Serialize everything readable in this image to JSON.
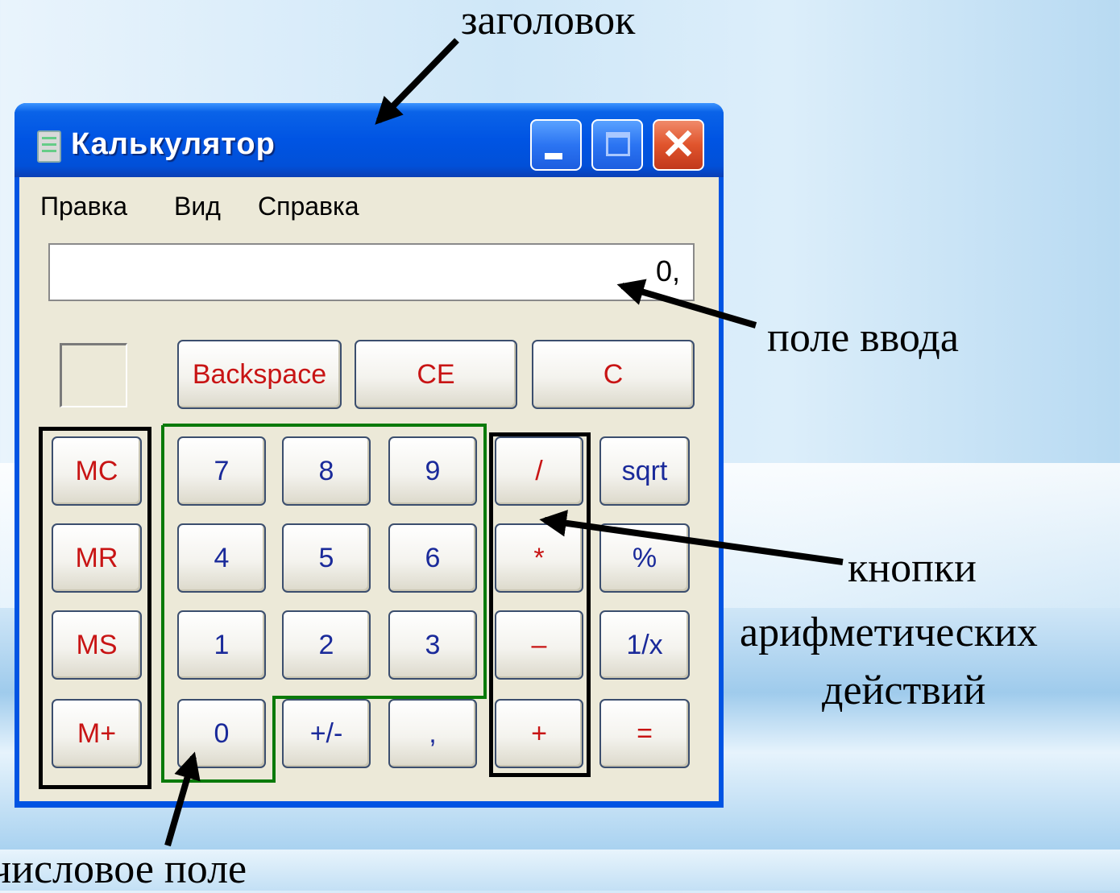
{
  "annotations": {
    "title_label": "заголовок",
    "input_label": "поле ввода",
    "ops_label_line1": "кнопки",
    "ops_label_line2": "арифметических",
    "ops_label_line3": "действий",
    "numpad_label": "числовое поле"
  },
  "window": {
    "title": "Калькулятор",
    "app_icon": "calculator-icon",
    "controls": [
      "minimize-icon",
      "maximize-icon",
      "close-icon"
    ]
  },
  "menu": {
    "items": [
      "Правка",
      "Вид",
      "Справка"
    ]
  },
  "display": {
    "value": "0,"
  },
  "buttons": {
    "backspace": "Backspace",
    "ce": "CE",
    "c": "C",
    "mc": "MC",
    "mr": "MR",
    "ms": "MS",
    "mplus": "M+",
    "d7": "7",
    "d8": "8",
    "d9": "9",
    "d4": "4",
    "d5": "5",
    "d6": "6",
    "d1": "1",
    "d2": "2",
    "d3": "3",
    "d0": "0",
    "sign": "+/-",
    "decimal": ",",
    "div": "/",
    "mul": "*",
    "sub": "–",
    "add": "+",
    "sqrt": "sqrt",
    "percent": "%",
    "recip": "1/x",
    "equals": "="
  },
  "colors": {
    "titlebar": "#0054e3",
    "client": "#ece9d8",
    "red_text": "#c81414",
    "blue_text": "#1a2a9a",
    "numpad_outline": "#0a7a0a"
  }
}
